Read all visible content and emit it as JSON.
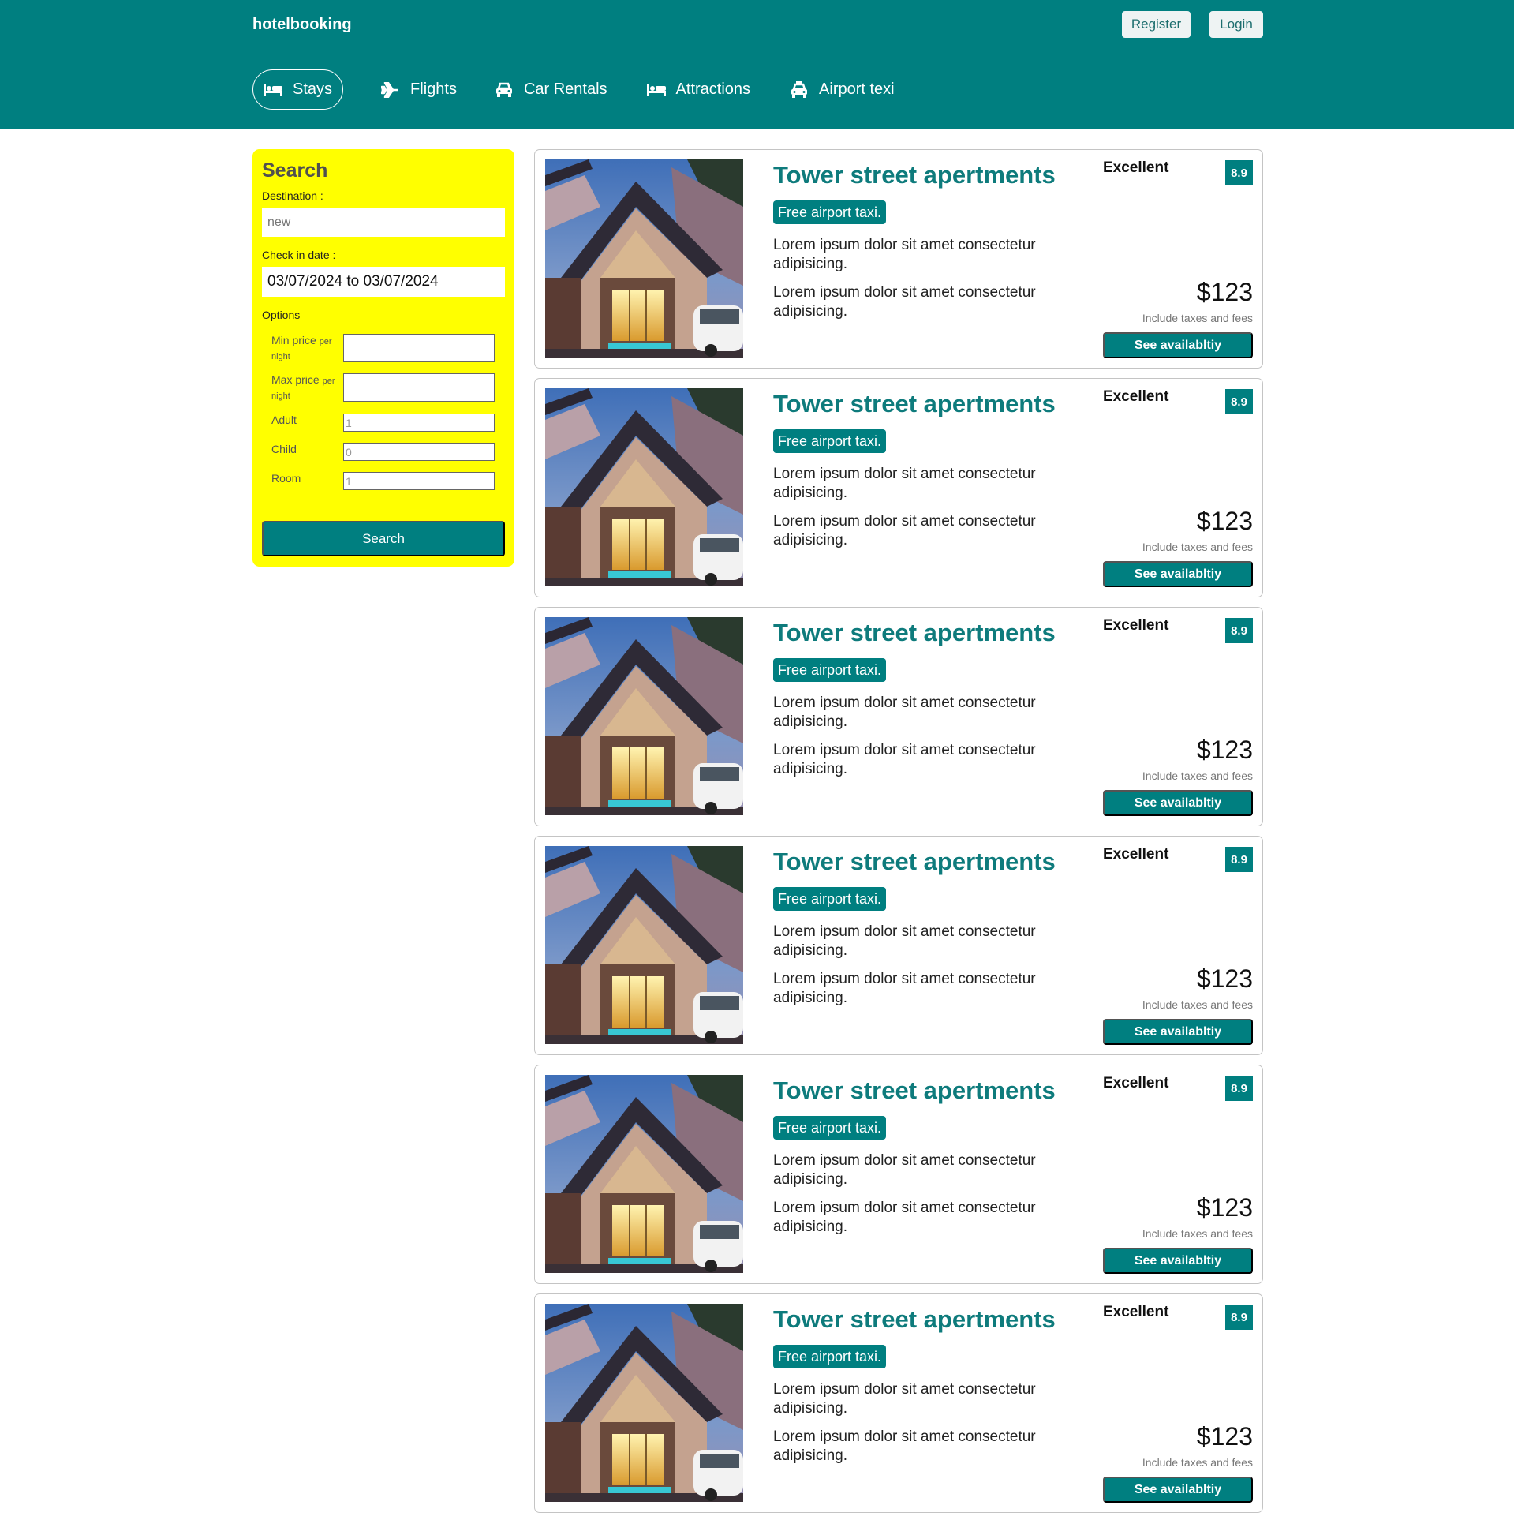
{
  "header": {
    "brand": "hotelbooking",
    "register_label": "Register",
    "login_label": "Login",
    "nav": [
      {
        "label": "Stays",
        "icon": "bed-icon",
        "active": true
      },
      {
        "label": "Flights",
        "icon": "plane-icon",
        "active": false
      },
      {
        "label": "Car Rentals",
        "icon": "car-icon",
        "active": false
      },
      {
        "label": "Attractions",
        "icon": "bed-icon",
        "active": false
      },
      {
        "label": "Airport texi",
        "icon": "taxi-icon",
        "active": false
      }
    ]
  },
  "search": {
    "title": "Search",
    "destination_label": "Destination :",
    "destination_placeholder": "new",
    "checkin_label": "Check in date :",
    "checkin_value": "03/07/2024 to 03/07/2024",
    "options_label": "Options",
    "min_price_label": "Min price",
    "min_price_suffix": "per night",
    "max_price_label": "Max price",
    "max_price_suffix": "per night",
    "adult_label": "Adult",
    "adult_value": "1",
    "child_label": "Child",
    "child_value": "0",
    "room_label": "Room",
    "room_value": "1",
    "button_label": "Search"
  },
  "results": [
    {
      "title": "Tower street apertments",
      "badge": "Free airport taxi.",
      "desc1": "Lorem ipsum dolor sit amet consectetur adipisicing.",
      "desc2": "Lorem ipsum dolor sit amet consectetur adipisicing.",
      "rating_text": "Excellent",
      "score": "8.9",
      "price": "$123",
      "tax_note": "Include taxes and fees",
      "button": "See availabltiy"
    },
    {
      "title": "Tower street apertments",
      "badge": "Free airport taxi.",
      "desc1": "Lorem ipsum dolor sit amet consectetur adipisicing.",
      "desc2": "Lorem ipsum dolor sit amet consectetur adipisicing.",
      "rating_text": "Excellent",
      "score": "8.9",
      "price": "$123",
      "tax_note": "Include taxes and fees",
      "button": "See availabltiy"
    },
    {
      "title": "Tower street apertments",
      "badge": "Free airport taxi.",
      "desc1": "Lorem ipsum dolor sit amet consectetur adipisicing.",
      "desc2": "Lorem ipsum dolor sit amet consectetur adipisicing.",
      "rating_text": "Excellent",
      "score": "8.9",
      "price": "$123",
      "tax_note": "Include taxes and fees",
      "button": "See availabltiy"
    },
    {
      "title": "Tower street apertments",
      "badge": "Free airport taxi.",
      "desc1": "Lorem ipsum dolor sit amet consectetur adipisicing.",
      "desc2": "Lorem ipsum dolor sit amet consectetur adipisicing.",
      "rating_text": "Excellent",
      "score": "8.9",
      "price": "$123",
      "tax_note": "Include taxes and fees",
      "button": "See availabltiy"
    },
    {
      "title": "Tower street apertments",
      "badge": "Free airport taxi.",
      "desc1": "Lorem ipsum dolor sit amet consectetur adipisicing.",
      "desc2": "Lorem ipsum dolor sit amet consectetur adipisicing.",
      "rating_text": "Excellent",
      "score": "8.9",
      "price": "$123",
      "tax_note": "Include taxes and fees",
      "button": "See availabltiy"
    },
    {
      "title": "Tower street apertments",
      "badge": "Free airport taxi.",
      "desc1": "Lorem ipsum dolor sit amet consectetur adipisicing.",
      "desc2": "Lorem ipsum dolor sit amet consectetur adipisicing.",
      "rating_text": "Excellent",
      "score": "8.9",
      "price": "$123",
      "tax_note": "Include taxes and fees",
      "button": "See availabltiy"
    }
  ],
  "colors": {
    "brand": "#007f80",
    "sidebar": "#ffff00",
    "title_text": "#0e7b7c"
  }
}
